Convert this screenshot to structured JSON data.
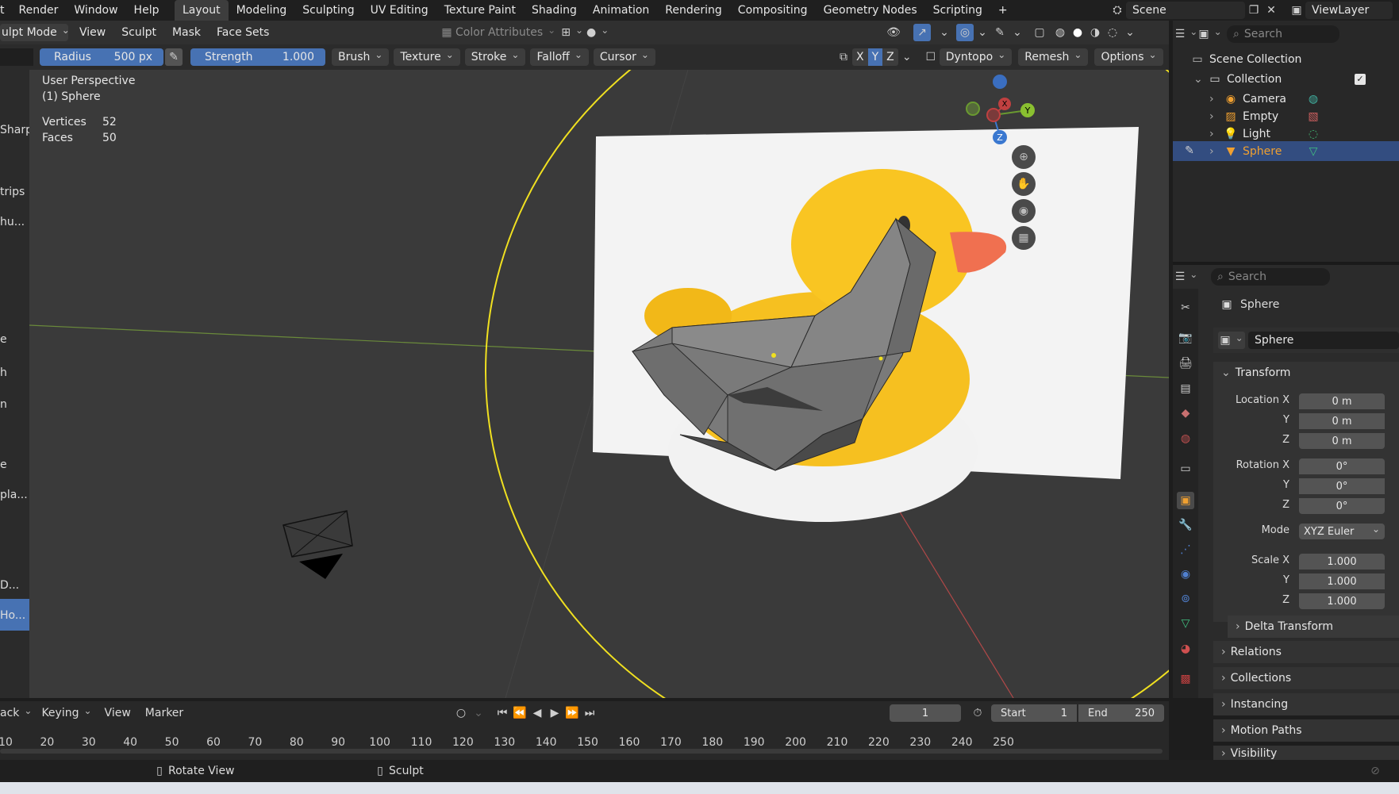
{
  "menu": {
    "items": [
      "t",
      "Render",
      "Window",
      "Help"
    ],
    "tabs": [
      "Layout",
      "Modeling",
      "Sculpting",
      "UV Editing",
      "Texture Paint",
      "Shading",
      "Animation",
      "Rendering",
      "Compositing",
      "Geometry Nodes",
      "Scripting"
    ],
    "active_tab": "Layout",
    "add_tab": "+",
    "scene": "Scene",
    "view_layer": "ViewLayer"
  },
  "header2": {
    "mode": "ulpt Mode",
    "items": [
      "View",
      "Sculpt",
      "Mask",
      "Face Sets"
    ],
    "color_attributes": "Color Attributes"
  },
  "toolbar": {
    "radius_label": "Radius",
    "radius_value": "500 px",
    "strength_label": "Strength",
    "strength_value": "1.000",
    "dropdowns": [
      "Brush",
      "Texture",
      "Stroke",
      "Falloff",
      "Cursor"
    ],
    "axes": [
      "X",
      "Y",
      "Z"
    ],
    "dyntopo": "Dyntopo",
    "remesh": "Remesh",
    "options": "Options"
  },
  "viewport": {
    "perspective": "User Perspective",
    "object": "(1) Sphere",
    "vertices_label": "Vertices",
    "vertices_value": "52",
    "faces_label": "Faces",
    "faces_value": "50",
    "gizmo": {
      "x": "X",
      "y": "Y",
      "z": "Z"
    }
  },
  "left_panel": {
    "items": [
      "Sharp",
      "trips",
      "hu...",
      "e",
      "h",
      "n",
      "e",
      "pla...",
      "D...",
      "Ho..."
    ]
  },
  "outliner": {
    "search_placeholder": "Search",
    "scene_collection": "Scene Collection",
    "collection": "Collection",
    "objects": [
      "Camera",
      "Empty",
      "Light",
      "Sphere"
    ],
    "selected": "Sphere"
  },
  "properties": {
    "search_placeholder": "Search",
    "object_name": "Sphere",
    "data_name": "Sphere",
    "transform_label": "Transform",
    "location_label": "Location X",
    "rotation_label": "Rotation X",
    "scale_label": "Scale X",
    "y_label": "Y",
    "z_label": "Z",
    "mode_label": "Mode",
    "location": [
      "0 m",
      "0 m",
      "0 m"
    ],
    "rotation": [
      "0°",
      "0°",
      "0°"
    ],
    "mode_value": "XYZ Euler",
    "scale": [
      "1.000",
      "1.000",
      "1.000"
    ],
    "sections": [
      "Delta Transform",
      "Relations",
      "Collections",
      "Instancing",
      "Motion Paths",
      "Visibility"
    ]
  },
  "timeline": {
    "items": [
      "ack",
      "Keying",
      "View",
      "Marker"
    ],
    "current_frame": "1",
    "start_label": "Start",
    "start_value": "1",
    "end_label": "End",
    "end_value": "250",
    "ticks": [
      "10",
      "20",
      "30",
      "40",
      "50",
      "60",
      "70",
      "80",
      "90",
      "100",
      "110",
      "120",
      "130",
      "140",
      "150",
      "160",
      "170",
      "180",
      "190",
      "200",
      "210",
      "220",
      "230",
      "240",
      "250"
    ]
  },
  "statusbar": {
    "rotate_view": "Rotate View",
    "sculpt": "Sculpt"
  },
  "colors": {
    "accent": "#4772b3",
    "selected_orange": "#f0a030",
    "viewport_bg": "#3a3a3a",
    "panel_bg": "#2b2b2b"
  }
}
